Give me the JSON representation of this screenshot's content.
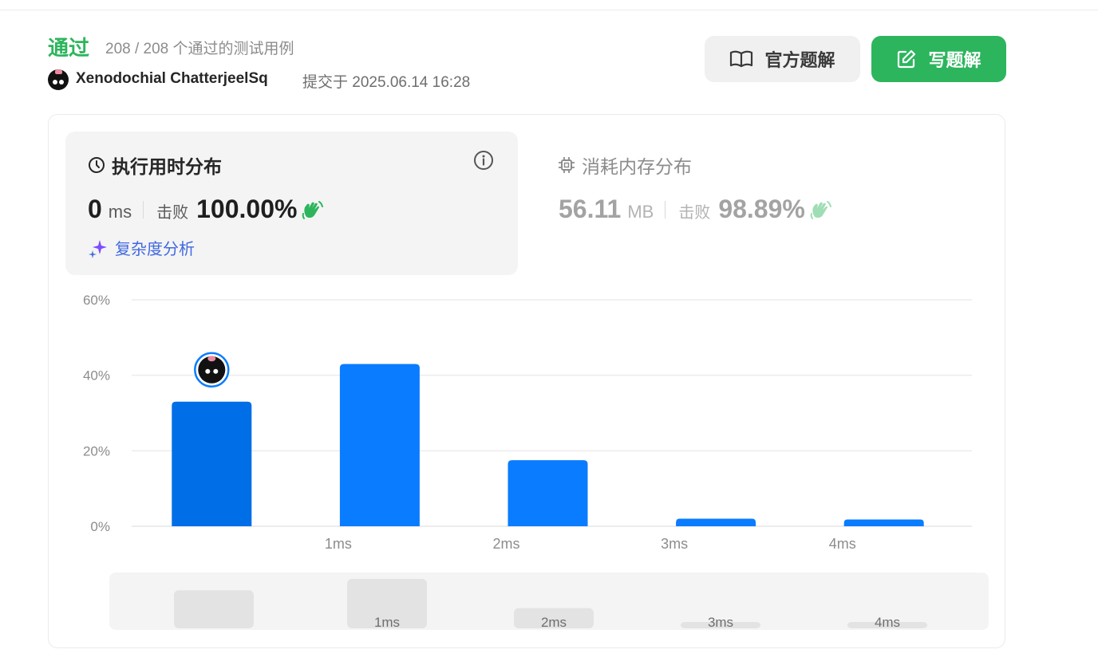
{
  "header": {
    "status": "通过",
    "count": "208 / 208 个通过的测试用例",
    "username": "Xenodochial ChatterjeelSq",
    "submitted_prefix": "提交于",
    "submitted_time": "2025.06.14 16:28",
    "submitted_full": "提交于 2025.06.14 16:28"
  },
  "buttons": {
    "official": "官方题解",
    "write": "写题解"
  },
  "runtime": {
    "title": "执行用时分布",
    "value": "0",
    "unit": "ms",
    "beats_label": "击败",
    "beats": "100.00%",
    "complexity": "复杂度分析"
  },
  "memory": {
    "title": "消耗内存分布",
    "value": "56.11",
    "unit": "MB",
    "beats_label": "击败",
    "beats": "98.89%"
  },
  "colors": {
    "accepted": "#2db55d",
    "bar": "#0a7cff",
    "bar_selected": "#006ee6",
    "ai_purple": "#7c4dff"
  },
  "chart_data": {
    "type": "bar",
    "categories": [
      "0ms",
      "1ms",
      "2ms",
      "3ms",
      "4ms"
    ],
    "x_tick_labels": [
      "",
      "1ms",
      "2ms",
      "3ms",
      "4ms"
    ],
    "values": [
      33,
      43,
      17.5,
      2,
      1.8
    ],
    "selected_index": 0,
    "y_ticks": [
      "0%",
      "20%",
      "40%",
      "60%"
    ],
    "ylim": [
      0,
      60
    ],
    "grid": true,
    "overview_labels": [
      "",
      "1ms",
      "2ms",
      "3ms",
      "4ms"
    ]
  }
}
